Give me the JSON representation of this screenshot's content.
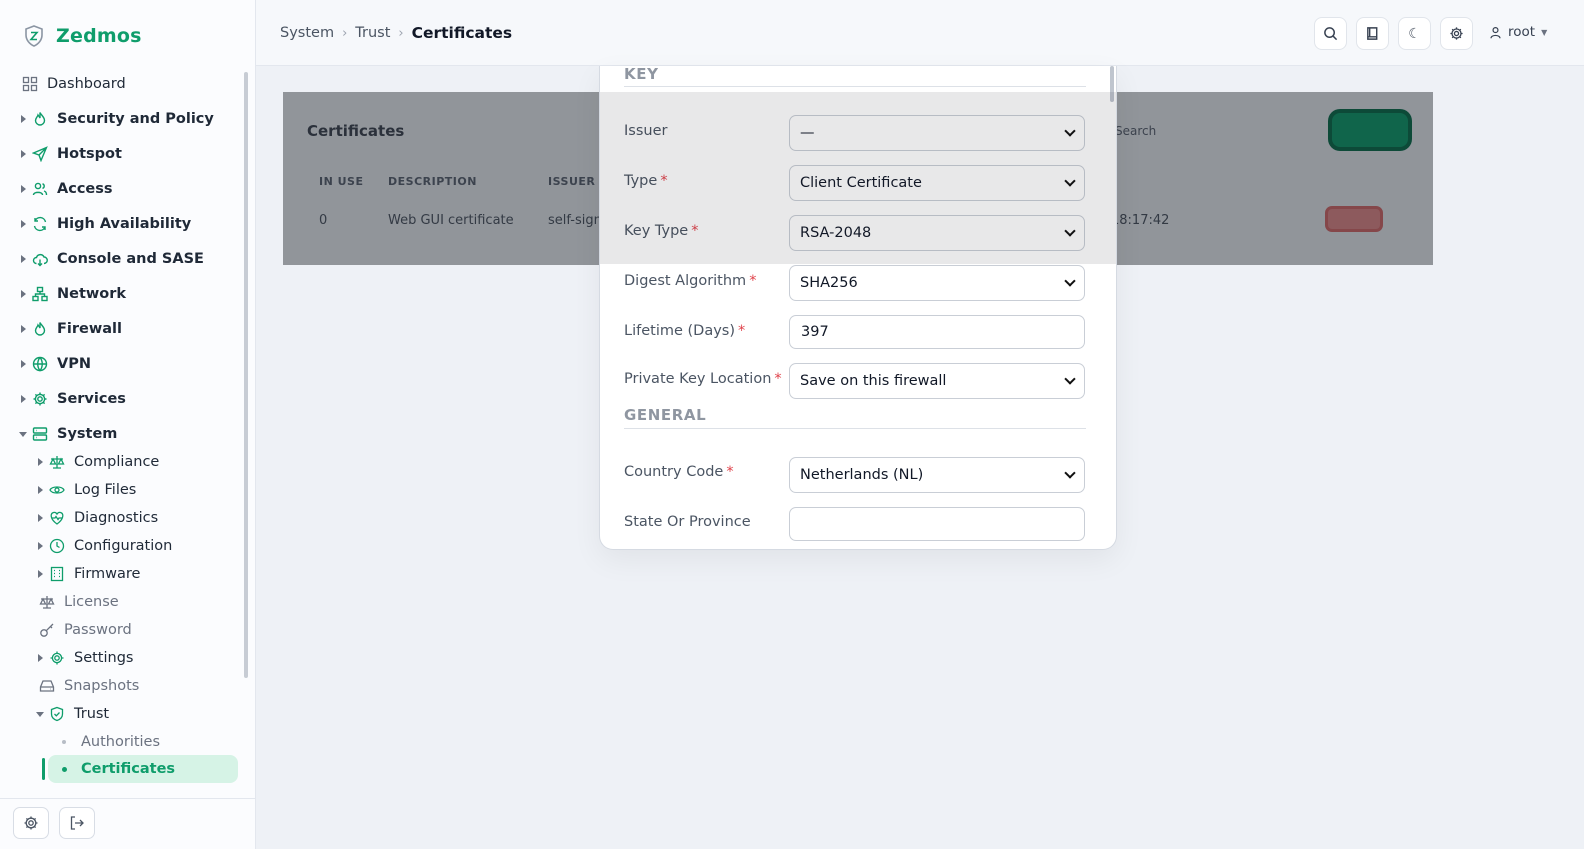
{
  "app": {
    "brand": "Zedmos"
  },
  "breadcrumbs": [
    "System",
    "Trust",
    "Certificates"
  ],
  "header": {
    "user": "root"
  },
  "sidebar": {
    "items": [
      {
        "label": "Dashboard",
        "icon": "grid-icon"
      },
      {
        "label": "Security and Policy",
        "icon": "flame-icon"
      },
      {
        "label": "Hotspot",
        "icon": "send-icon"
      },
      {
        "label": "Access",
        "icon": "users-icon"
      },
      {
        "label": "High Availability",
        "icon": "refresh-icon"
      },
      {
        "label": "Console and SASE",
        "icon": "cloud-icon"
      },
      {
        "label": "Network",
        "icon": "network-icon"
      },
      {
        "label": "Firewall",
        "icon": "flame-icon"
      },
      {
        "label": "VPN",
        "icon": "globe-icon"
      },
      {
        "label": "Services",
        "icon": "gear-icon"
      },
      {
        "label": "System",
        "icon": "server-icon"
      }
    ],
    "system_children": [
      {
        "label": "Compliance",
        "icon": "scale-icon"
      },
      {
        "label": "Log Files",
        "icon": "eye-icon"
      },
      {
        "label": "Diagnostics",
        "icon": "heart-icon"
      },
      {
        "label": "Configuration",
        "icon": "clock-icon"
      },
      {
        "label": "Firmware",
        "icon": "building-icon"
      },
      {
        "label": "License",
        "icon": "scale-icon"
      },
      {
        "label": "Password",
        "icon": "key-icon"
      },
      {
        "label": "Settings",
        "icon": "gear-icon"
      },
      {
        "label": "Snapshots",
        "icon": "drive-icon"
      },
      {
        "label": "Trust",
        "icon": "shield-check-icon"
      }
    ],
    "trust_children": [
      {
        "label": "Authorities"
      },
      {
        "label": "Certificates"
      }
    ]
  },
  "card": {
    "title": "Certificates",
    "search_placeholder": "Search",
    "columns": [
      "IN USE",
      "DESCRIPTION",
      "ISSUER"
    ],
    "row": {
      "in_use": "0",
      "description": "Web GUI certificate",
      "issuer": "self-signed",
      "time": "18:17:42"
    }
  },
  "modal": {
    "section_key": "KEY",
    "section_general": "GENERAL",
    "fields": {
      "issuer": {
        "label": "Issuer",
        "value": "—"
      },
      "type": {
        "label": "Type",
        "value": "Client Certificate"
      },
      "key_type": {
        "label": "Key Type",
        "value": "RSA-2048"
      },
      "digest": {
        "label": "Digest Algorithm",
        "value": "SHA256"
      },
      "lifetime": {
        "label": "Lifetime (Days)",
        "value": "397"
      },
      "pk_location": {
        "label": "Private Key Location",
        "value": "Save on this firewall"
      },
      "country": {
        "label": "Country Code",
        "value": "Netherlands (NL)"
      },
      "state": {
        "label": "State Or Province",
        "value": ""
      }
    },
    "required_marker": "*"
  },
  "colors": {
    "accent": "#0f9d6b",
    "danger": "#e0424a"
  }
}
